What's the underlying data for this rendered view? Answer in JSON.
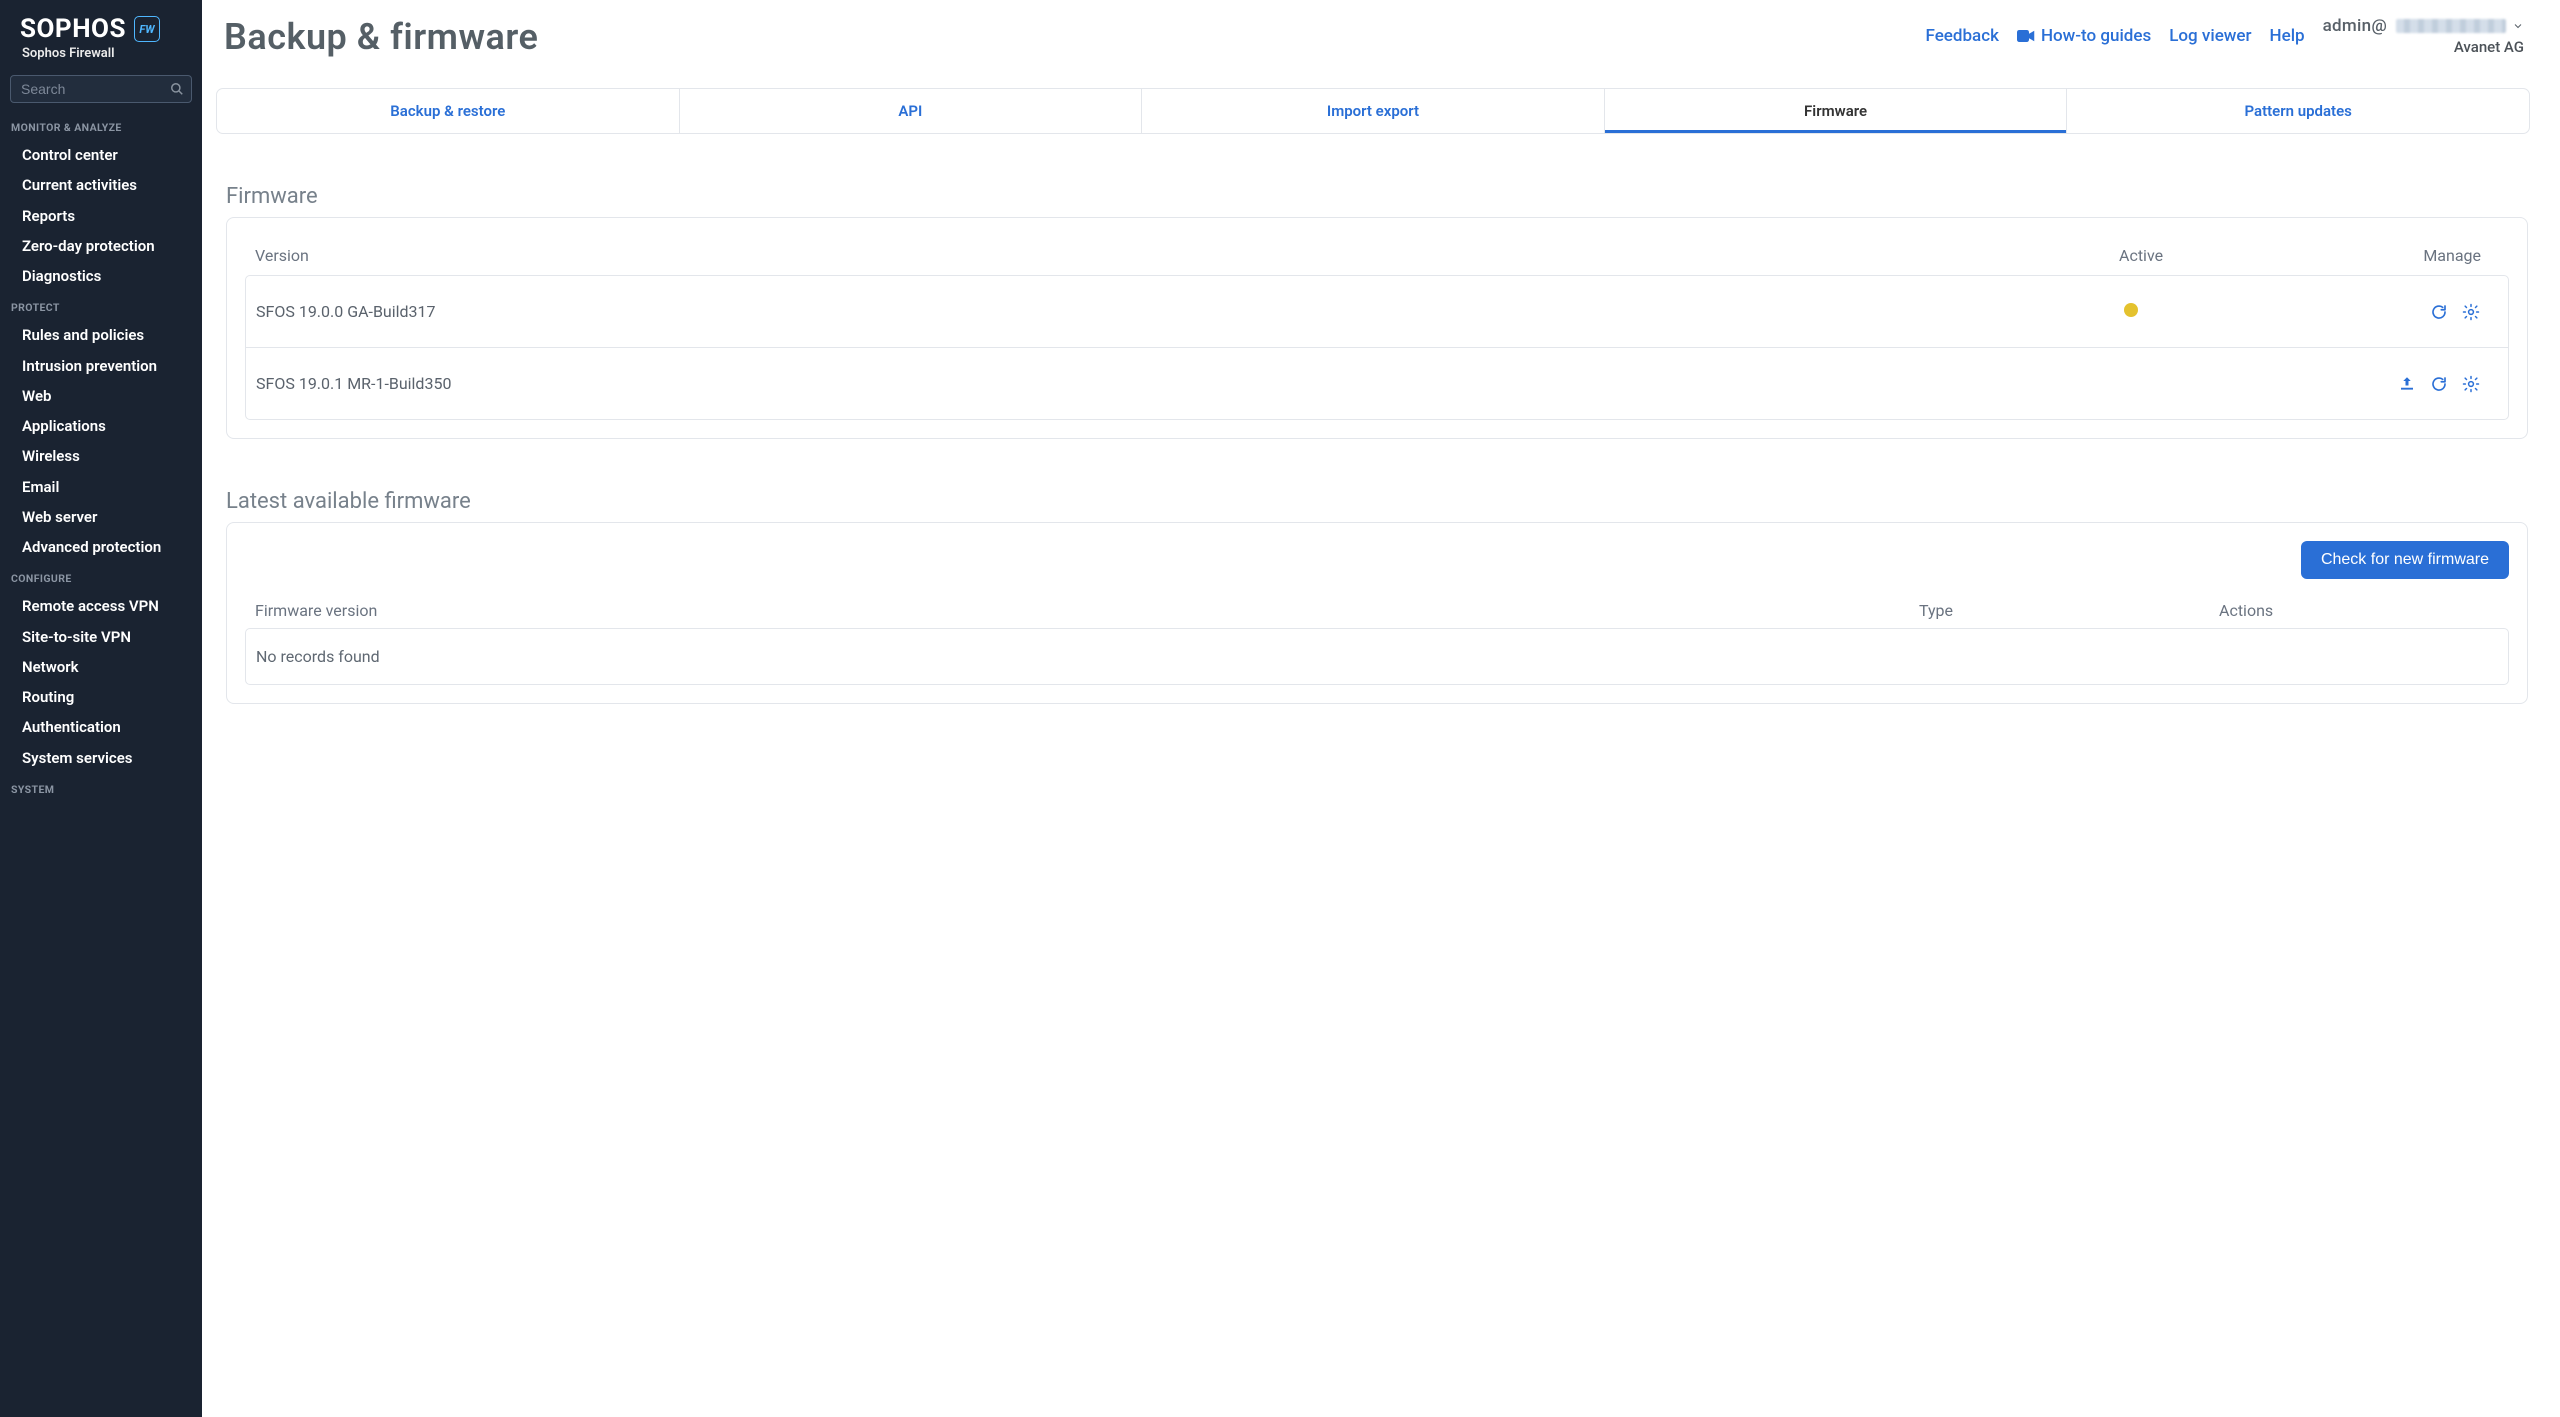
{
  "brand": {
    "name": "SOPHOS",
    "product": "Sophos Firewall",
    "badge": "FW"
  },
  "search": {
    "placeholder": "Search"
  },
  "nav": {
    "groups": [
      {
        "heading": "MONITOR & ANALYZE",
        "items": [
          "Control center",
          "Current activities",
          "Reports",
          "Zero-day protection",
          "Diagnostics"
        ]
      },
      {
        "heading": "PROTECT",
        "items": [
          "Rules and policies",
          "Intrusion prevention",
          "Web",
          "Applications",
          "Wireless",
          "Email",
          "Web server",
          "Advanced protection"
        ]
      },
      {
        "heading": "CONFIGURE",
        "items": [
          "Remote access VPN",
          "Site-to-site VPN",
          "Network",
          "Routing",
          "Authentication",
          "System services"
        ]
      },
      {
        "heading": "SYSTEM",
        "items": []
      }
    ]
  },
  "header": {
    "title": "Backup & firmware",
    "links": {
      "feedback": "Feedback",
      "howto": "How-to guides",
      "logviewer": "Log viewer",
      "help": "Help"
    },
    "user": {
      "prefix": "admin@",
      "company": "Avanet AG"
    }
  },
  "tabs": [
    "Backup & restore",
    "API",
    "Import export",
    "Firmware",
    "Pattern updates"
  ],
  "tabs_active_index": 3,
  "firmware": {
    "title": "Firmware",
    "cols": {
      "version": "Version",
      "active": "Active",
      "manage": "Manage"
    },
    "rows": [
      {
        "version": "SFOS 19.0.0 GA-Build317",
        "active": true,
        "upload": false
      },
      {
        "version": "SFOS 19.0.1 MR-1-Build350",
        "active": false,
        "upload": true
      }
    ]
  },
  "latest": {
    "title": "Latest available firmware",
    "button": "Check for new firmware",
    "cols": {
      "version": "Firmware version",
      "type": "Type",
      "actions": "Actions"
    },
    "empty": "No records found"
  }
}
